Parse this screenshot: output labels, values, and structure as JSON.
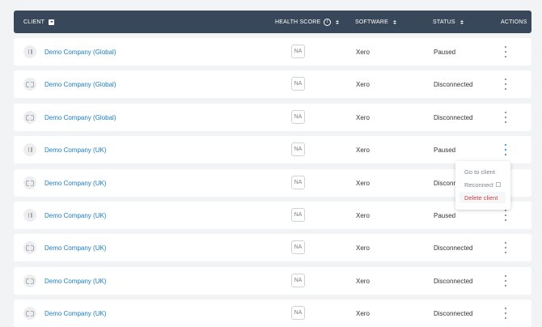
{
  "header": {
    "client": "CLIENT",
    "health_score": "HEALTH SCORE",
    "info": "i",
    "software": "SOFTWARE",
    "status": "STATUS",
    "actions": "ACTIONS"
  },
  "rows": [
    {
      "name": "Demo Company (Global)",
      "state_icon": "pause-icon",
      "health": "NA",
      "software": "Xero",
      "status": "Paused"
    },
    {
      "name": "Demo Company (Global)",
      "state_icon": "disconnected-icon",
      "health": "NA",
      "software": "Xero",
      "status": "Disconnected"
    },
    {
      "name": "Demo Company (Global)",
      "state_icon": "disconnected-icon",
      "health": "NA",
      "software": "Xero",
      "status": "Disconnected"
    },
    {
      "name": "Demo Company (UK)",
      "state_icon": "pause-icon",
      "health": "NA",
      "software": "Xero",
      "status": "Paused"
    },
    {
      "name": "Demo Company (UK)",
      "state_icon": "disconnected-icon",
      "health": "NA",
      "software": "Xero",
      "status": "Disconnected"
    },
    {
      "name": "Demo Company (UK)",
      "state_icon": "pause-icon",
      "health": "NA",
      "software": "Xero",
      "status": "Paused"
    },
    {
      "name": "Demo Company (UK)",
      "state_icon": "disconnected-icon",
      "health": "NA",
      "software": "Xero",
      "status": "Disconnected"
    },
    {
      "name": "Demo Company (UK)",
      "state_icon": "disconnected-icon",
      "health": "NA",
      "software": "Xero",
      "status": "Disconnected"
    },
    {
      "name": "Demo Company (UK)",
      "state_icon": "disconnected-icon",
      "health": "NA",
      "software": "Xero",
      "status": "Disconnected"
    }
  ],
  "menu": {
    "go_to_client": "Go to client",
    "reconnect": "Reconnect",
    "delete_client": "Delete client"
  },
  "colors": {
    "header_bg": "#39475a",
    "link": "#1a7fc1",
    "danger": "#d63b3b"
  }
}
